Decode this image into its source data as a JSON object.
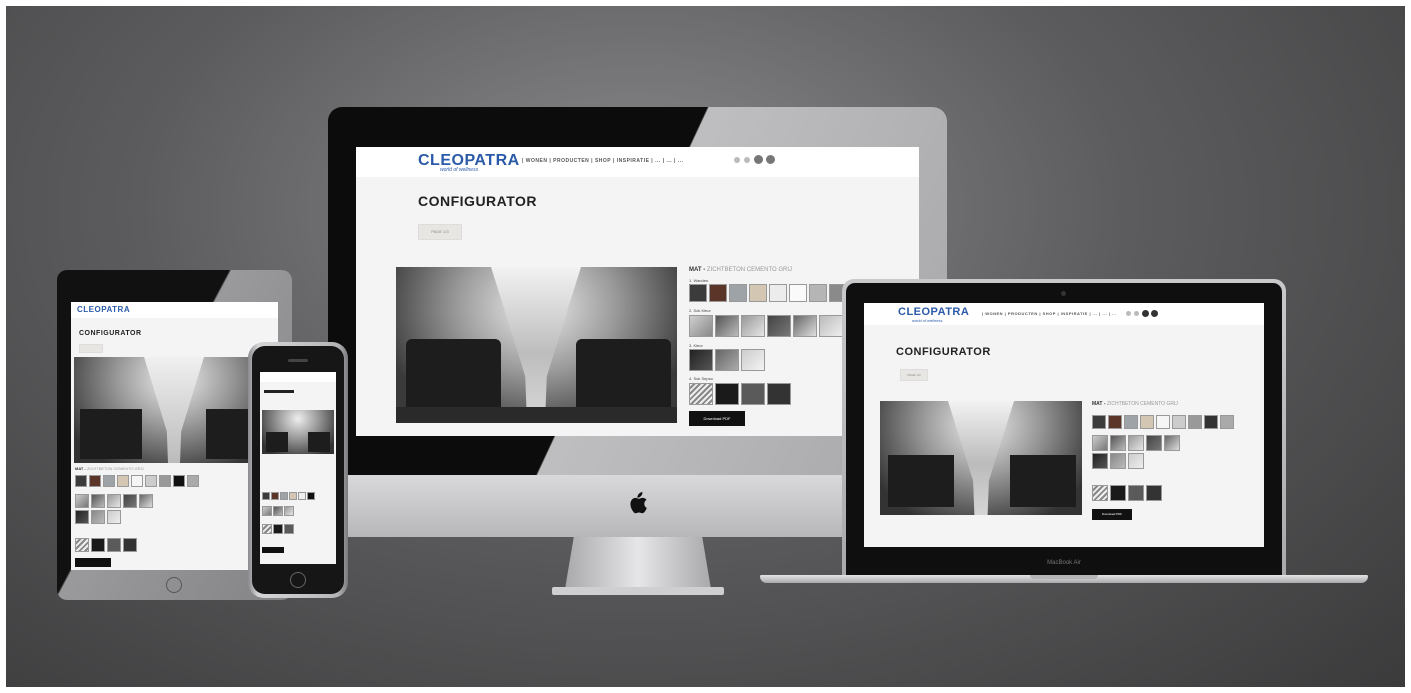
{
  "brand": {
    "logo": "CLEOPATRA",
    "tagline": "world of wellness"
  },
  "nav": {
    "items": "| WONEN | PRODUCTEN | SHOP | INSPIRATIE | ... | ... | ..."
  },
  "page": {
    "title": "CONFIGURATOR",
    "pill": "PAGE 1/3"
  },
  "material": {
    "label": "MAT -",
    "value": "ZICHTBETON CEMENTO GRIJ"
  },
  "sections": [
    "1. Wanden",
    "2. Sok Kleur",
    "3. Kleur",
    "4. Sok Sepso"
  ],
  "download": "Download PDF",
  "laptop_brand": "MacBook Air",
  "colors": {
    "bg_dark": "#3a3a3b",
    "brand_blue": "#2a5aa8",
    "screen_bg": "#f4f4f4"
  }
}
